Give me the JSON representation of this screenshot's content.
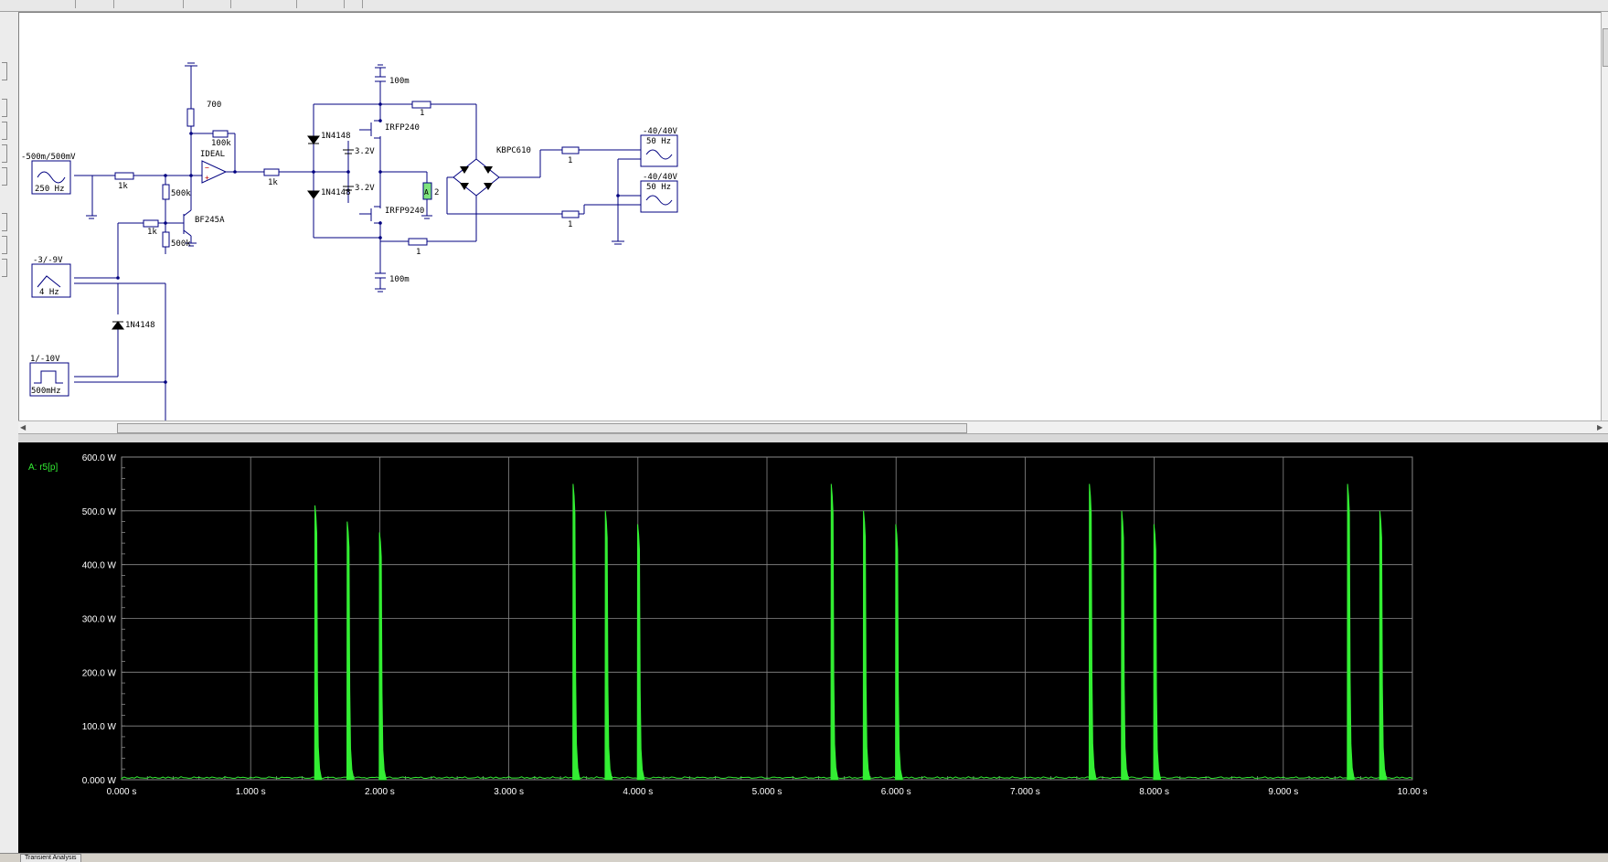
{
  "schematic": {
    "sources": {
      "sine_input": {
        "amplitude": "-500m/500mV",
        "frequency": "250 Hz"
      },
      "sawtooth": {
        "amplitude": "-3/-9V",
        "frequency": "4 Hz"
      },
      "pulse": {
        "amplitude": "1/-10V",
        "frequency": "500mHz"
      },
      "mains_top": {
        "amplitude": "-40/40V",
        "frequency": "50 Hz"
      },
      "mains_bottom": {
        "amplitude": "-40/40V",
        "frequency": "50 Hz"
      }
    },
    "components": {
      "r_700": "700",
      "r_100k": "100k",
      "opamp": "IDEAL",
      "r_in_1k": "1k",
      "r_out_1k": "1k",
      "r_500k_top": "500k",
      "r_500k_bottom": "500k",
      "r_gate_1k": "1k",
      "jfet": "BF245A",
      "diode_top": "1N4148",
      "diode_bottom": "1N4148",
      "diode_left": "1N4148",
      "bias_top": "3.2V",
      "bias_bottom": "3.2V",
      "nmos": "IRFP240",
      "pmos": "IRFP9240",
      "cap_top": "100m",
      "cap_bottom": "100m",
      "r_drain_top": "1",
      "r_drain_bottom": "1",
      "r_load": "2",
      "r_load_tag": "A",
      "bridge": "KBPC610",
      "r_mains_top": "1",
      "r_mains_bottom": "1"
    }
  },
  "plot": {
    "trace_label": "A: r5[p]",
    "trace_color": "#33ee33",
    "grid_color": "#8a8a8a",
    "background": "#000000"
  },
  "chart_data": {
    "type": "line",
    "series": [
      {
        "name": "A: r5[p]",
        "color": "#33ee33"
      }
    ],
    "xlim": [
      0,
      10
    ],
    "ylim": [
      0,
      600
    ],
    "x_ticks": [
      "0.000 s",
      "1.000 s",
      "2.000 s",
      "3.000 s",
      "4.000 s",
      "5.000 s",
      "6.000 s",
      "7.000 s",
      "8.000 s",
      "9.000 s",
      "10.00 s"
    ],
    "y_ticks": [
      "0.000 W",
      "100.0 W",
      "200.0 W",
      "300.0 W",
      "400.0 W",
      "500.0 W",
      "600.0 W"
    ],
    "grid": true,
    "pulses": [
      {
        "t": 1.5,
        "peak": 510
      },
      {
        "t": 1.75,
        "peak": 480
      },
      {
        "t": 2.0,
        "peak": 460
      },
      {
        "t": 3.5,
        "peak": 550
      },
      {
        "t": 3.75,
        "peak": 500
      },
      {
        "t": 4.0,
        "peak": 475
      },
      {
        "t": 5.5,
        "peak": 550
      },
      {
        "t": 5.75,
        "peak": 500
      },
      {
        "t": 6.0,
        "peak": 475
      },
      {
        "t": 7.5,
        "peak": 550
      },
      {
        "t": 7.75,
        "peak": 500
      },
      {
        "t": 8.0,
        "peak": 475
      },
      {
        "t": 9.5,
        "peak": 550
      },
      {
        "t": 9.75,
        "peak": 500
      }
    ]
  },
  "status": {
    "tab_label": "Transient Analysis"
  }
}
